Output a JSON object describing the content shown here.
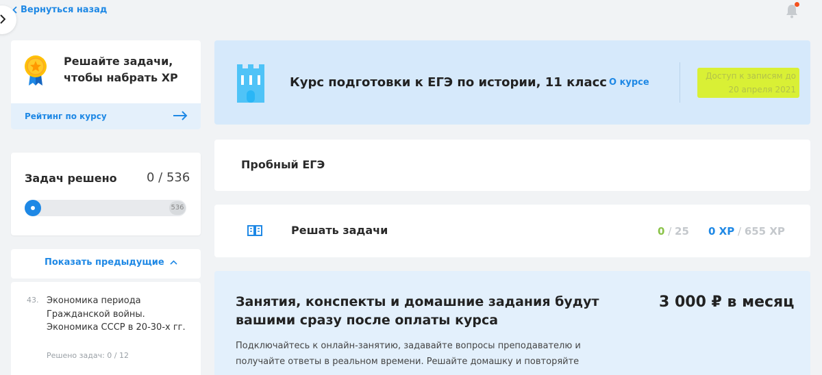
{
  "nav": {
    "back_label": "Вернуться назад"
  },
  "sidebar": {
    "xp_card": {
      "title": "Решайте задачи, чтобы набрать XP",
      "rating_label": "Рейтинг по курсу"
    },
    "progress": {
      "label": "Задач решено",
      "count": "0 / 536",
      "total_badge": "536",
      "fraction": 0
    },
    "show_previous_label": "Показать предыдущие",
    "topic": {
      "number": "43.",
      "title": "Экономика периода Гражданской войны. Экономика СССР в 20-30-х гг.",
      "meta": "Решено задач: 0 / 12"
    }
  },
  "course": {
    "title": "Курс подготовки к ЕГЭ по истории, 11 класс",
    "about_link": "О курсе",
    "access_text": "Доступ к записям до 20 апреля 2021"
  },
  "trial": {
    "title": "Пробный ЕГЭ"
  },
  "solve": {
    "title": "Решать задачи",
    "done": "0",
    "sep": " / ",
    "total": "25",
    "xp_now": "0 XP",
    "xp_total": "655 XP"
  },
  "promo": {
    "title": "Занятия, конспекты и домашние задания будут вашими сразу после оплаты курса",
    "price": "3 000 ₽ в месяц",
    "description": "Подключайтесь к онлайн-занятию, задавайте вопросы преподавателю и получайте ответы в реальном времени. Решайте домашку и повторяйте"
  },
  "colors": {
    "accent": "#1e88e5",
    "success": "#8bc34a",
    "banner_bg": "#d6e9fb",
    "highlight": "#d9f035"
  },
  "icons": [
    "chevron-right-icon",
    "chevron-left-icon",
    "bell-icon",
    "medal-icon",
    "arrow-right-icon",
    "chevron-up-icon",
    "castle-icon",
    "book-icon"
  ]
}
